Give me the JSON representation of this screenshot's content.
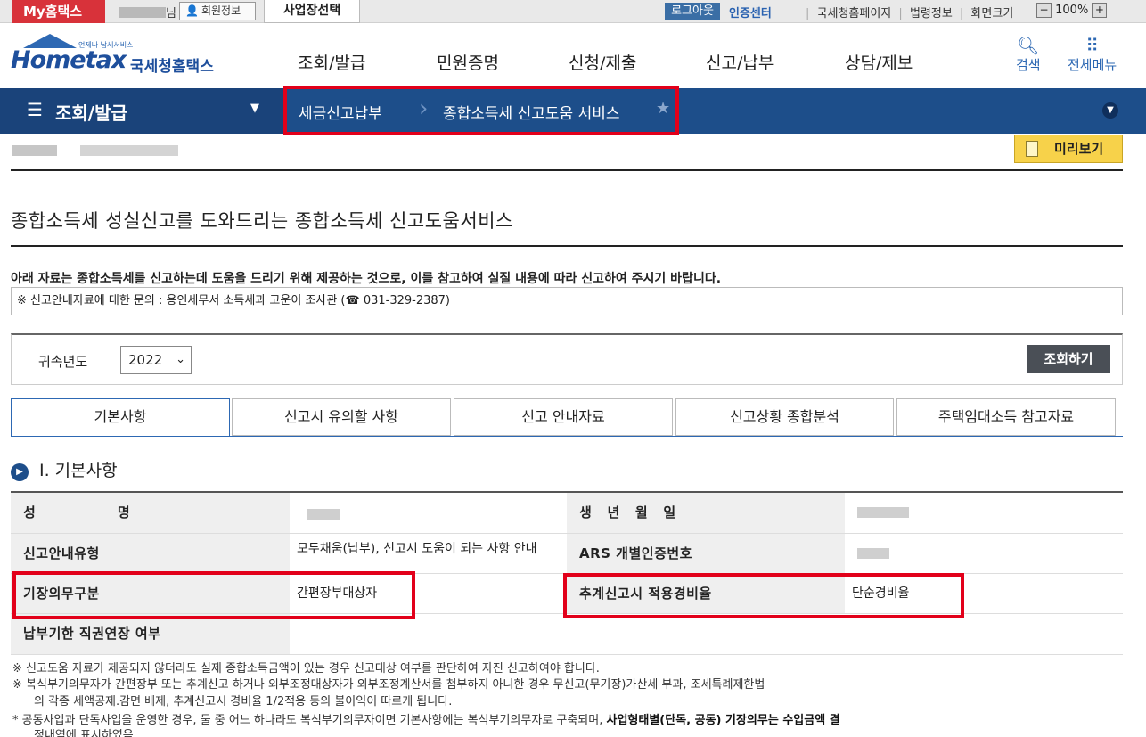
{
  "topbar": {
    "my_hometax": "My홈택스",
    "name_suffix": "님",
    "member_info": "회원정보",
    "business_select": "사업장선택",
    "logout": "로그아웃",
    "cert_center": "인증센터",
    "links": [
      "국세청홈페이지",
      "법령정보",
      "화면크기"
    ],
    "zoom_minus": "−",
    "zoom_level": "100%",
    "zoom_plus": "+"
  },
  "header": {
    "logo_small": "언제나 납세서비스",
    "logo_main": "Hometax",
    "logo_kr": "국세청홈택스",
    "nav": [
      "조회/발급",
      "민원증명",
      "신청/제출",
      "신고/납부",
      "상담/제보"
    ],
    "search": "검색",
    "all_menu": "전체메뉴"
  },
  "locbar": {
    "menu_title": "조회/발급",
    "crumb1": "세금신고납부",
    "crumb2": "종합소득세 신고도움 서비스"
  },
  "page": {
    "preview": "미리보기",
    "heading": "종합소득세 성실신고를 도와드리는 종합소득세 신고도움서비스",
    "notice": "아래 자료는 종합소득세를 신고하는데 도움을 드리기 위해 제공하는 것으로, 이를 참고하여 실질 내용에 따라 신고하여 주시기 바랍니다.",
    "inquiry": "※ 신고안내자료에 대한 문의 : 용인세무서 소득세과 고운이 조사관 (☎ 031-329-2387)"
  },
  "search": {
    "label": "귀속년도",
    "year": "2022",
    "button": "조회하기"
  },
  "tabs": [
    "기본사항",
    "신고시 유의할 사항",
    "신고 안내자료",
    "신고상황 종합분석",
    "주택임대소득 참고자료"
  ],
  "section": {
    "number": "Ⅰ",
    "title": "Ⅰ. 기본사항"
  },
  "table": {
    "name_label": "성                명",
    "birth_label": "생   년   월   일",
    "guide_type_label": "신고안내유형",
    "guide_type_value": "모두채움(납부), 신고시 도움이 되는 사항 안내",
    "ars_label": "ARS 개별인증번호",
    "bookkeeping_label": "기장의무구분",
    "bookkeeping_value": "간편장부대상자",
    "expense_rate_label": "추계신고시 적용경비율",
    "expense_rate_value": "단순경비율",
    "deadline_label": "납부기한 직권연장 여부"
  },
  "footnotes": [
    "※  신고도움 자료가 제공되지 않더라도 실제 종합소득금액이 있는 경우 신고대상 여부를 판단하여 자진 신고하여야 합니다.",
    "※  복식부기의무자가 간편장부 또는 추계신고 하거나 외부조정대상자가 외부조정계산서를 첨부하지 아니한 경우 무신고(무기장)가산세 부과, 조세특례제한법",
    "의 각종 세액공제.감면 배제, 추계신고시 경비율 1/2적용 등의 불이익이 따르게 됩니다.",
    "*  공동사업과 단독사업을 운영한 경우, 둘 중 어느 하나라도 복식부기의무자이면 기본사항에는 복식부기의무자로 구축되며,",
    "사업형태별(단독, 공동) 기장의무는 수입금액 결",
    "정내역에 표시하였음"
  ],
  "colors": {
    "brand_blue": "#1d4e8a",
    "accent_red": "#e2001a",
    "preview_yellow": "#f7d24a"
  }
}
